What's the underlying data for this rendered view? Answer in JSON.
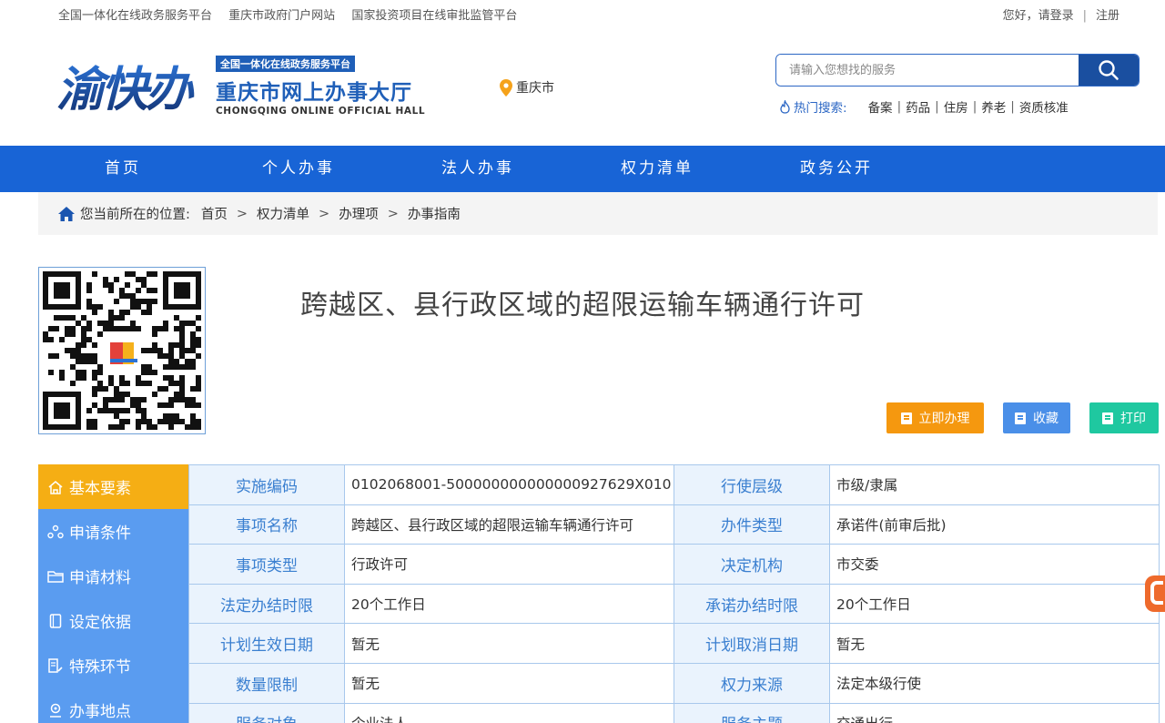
{
  "topbar": {
    "links": [
      "全国一体化在线政务服务平台",
      "重庆市政府门户网站",
      "国家投资项目在线审批监管平台"
    ],
    "greeting": "您好，请登录",
    "register": "注册"
  },
  "header": {
    "logo_mark": "渝快办",
    "logo_tag": "全国一体化在线政务服务平台",
    "logo_name": "重庆市网上办事大厅",
    "logo_en": "CHONGQING ONLINE OFFICIAL HALL",
    "location": "重庆市",
    "search_placeholder": "请输入您想找的服务",
    "hot_label": "热门搜索:",
    "hot_keywords": [
      "备案",
      "药品",
      "住房",
      "养老",
      "资质核准"
    ]
  },
  "nav": {
    "items": [
      "首页",
      "个人办事",
      "法人办事",
      "权力清单",
      "政务公开"
    ]
  },
  "breadcrumb": {
    "label": "您当前所在的位置:",
    "items": [
      "首页",
      "权力清单",
      "办理项",
      "办事指南"
    ]
  },
  "main": {
    "title": "跨越区、县行政区域的超限运输车辆通行许可",
    "actions": [
      {
        "label": "立即办理",
        "color": "#f5980f"
      },
      {
        "label": "收藏",
        "color": "#4a8fe8"
      },
      {
        "label": "打印",
        "color": "#1fc8a0"
      }
    ]
  },
  "sidebar": {
    "items": [
      "基本要素",
      "申请条件",
      "申请材料",
      "设定依据",
      "特殊环节",
      "办事地点"
    ],
    "active_index": 0
  },
  "info_table": {
    "rows": [
      [
        {
          "k": "实施编码",
          "v": "0102068001-500000000000000927629X010"
        },
        {
          "k": "行使层级",
          "v": "市级/隶属"
        }
      ],
      [
        {
          "k": "事项名称",
          "v": "跨越区、县行政区域的超限运输车辆通行许可"
        },
        {
          "k": "办件类型",
          "v": "承诺件(前审后批)"
        }
      ],
      [
        {
          "k": "事项类型",
          "v": "行政许可"
        },
        {
          "k": "决定机构",
          "v": "市交委"
        }
      ],
      [
        {
          "k": "法定办结时限",
          "v": "20个工作日"
        },
        {
          "k": "承诺办结时限",
          "v": "20个工作日"
        }
      ],
      [
        {
          "k": "计划生效日期",
          "v": "暂无"
        },
        {
          "k": "计划取消日期",
          "v": "暂无"
        }
      ],
      [
        {
          "k": "数量限制",
          "v": "暂无"
        },
        {
          "k": "权力来源",
          "v": "法定本级行使"
        }
      ],
      [
        {
          "k": "服务对象",
          "v": "企业法人"
        },
        {
          "k": "服务主题",
          "v": "交通出行"
        }
      ]
    ]
  },
  "colors": {
    "nav_blue": "#1864d6",
    "sidebar_blue": "#5a9cf0",
    "sidebar_active": "#f5ae14",
    "key_text": "#3a7fd0"
  }
}
